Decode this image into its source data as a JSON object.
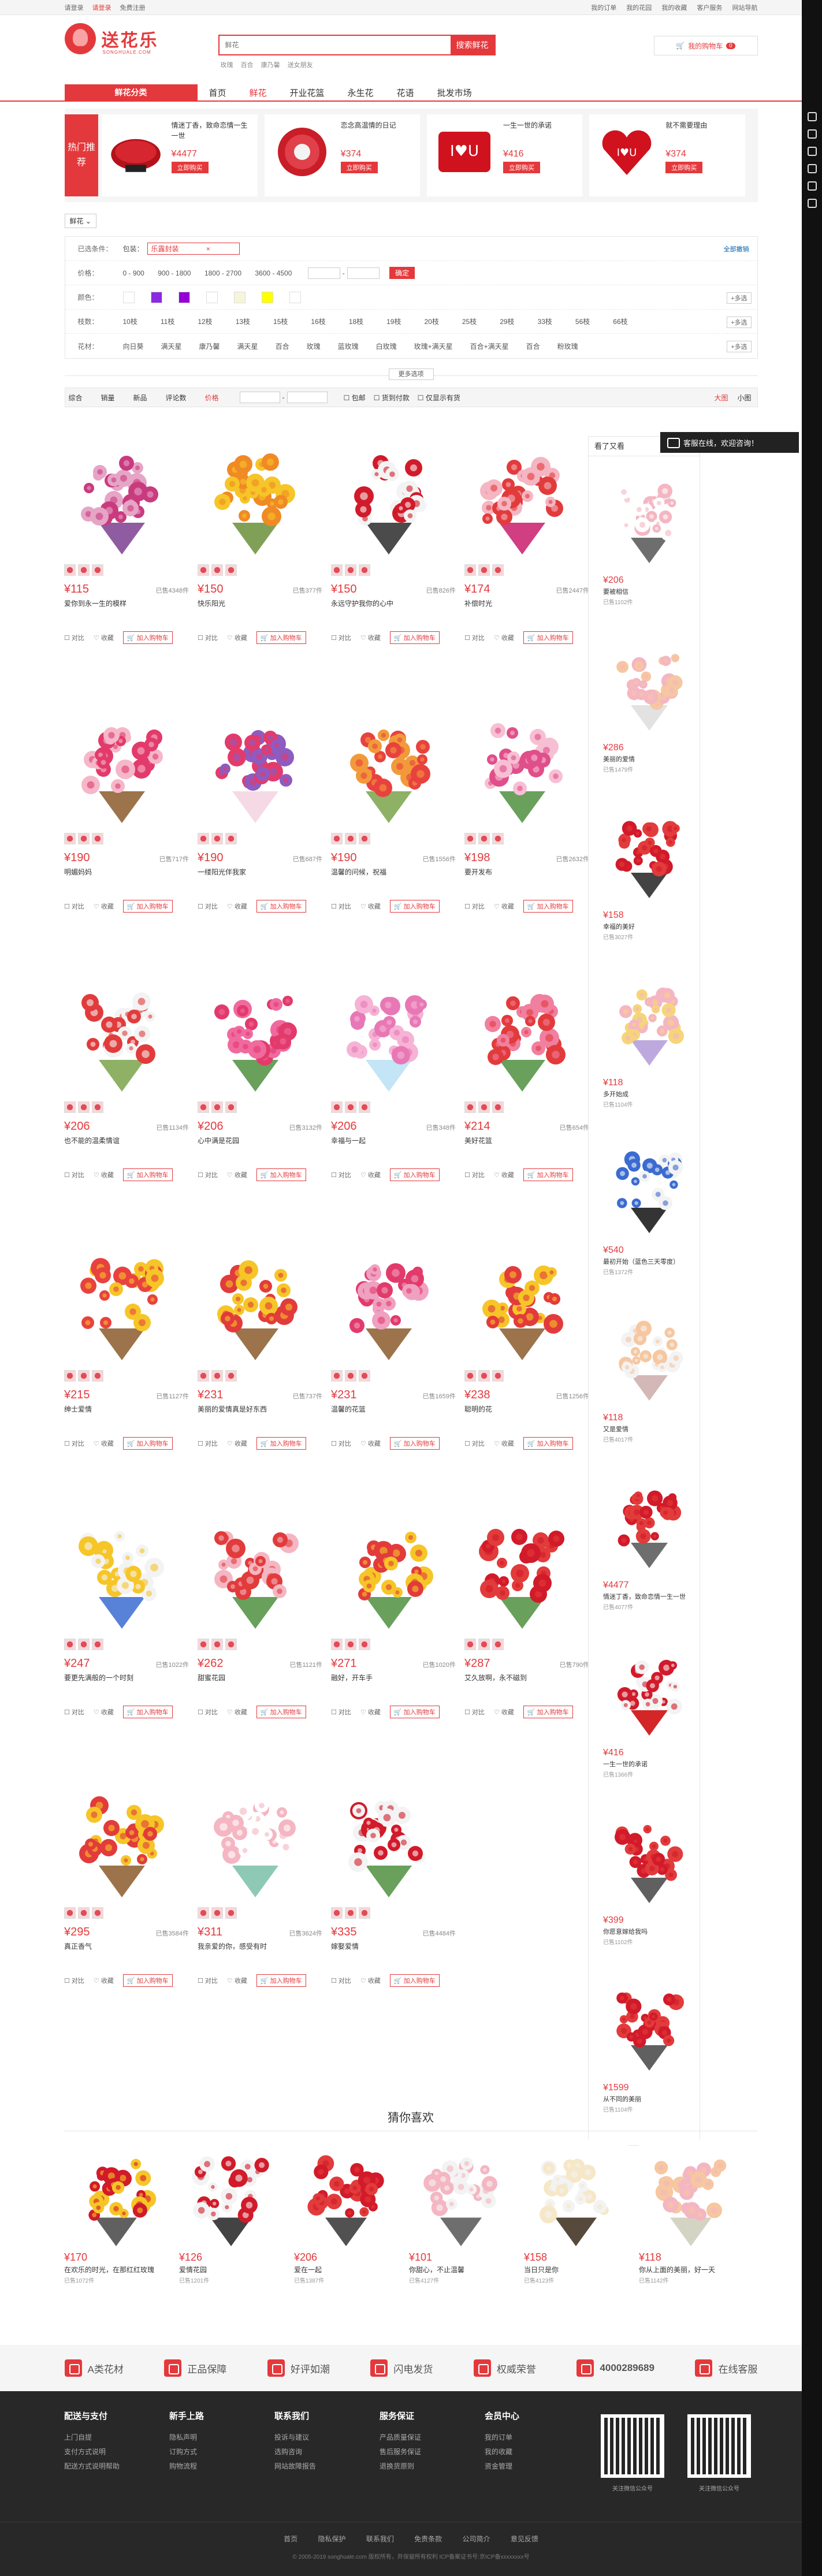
{
  "topbar": {
    "location": "请登录",
    "login": "请登录",
    "register": "免费注册",
    "right": [
      "我的订单",
      "我的花园",
      "我的收藏",
      "客户服务",
      "网站导航"
    ]
  },
  "header": {
    "logo_text": "送花乐",
    "logo_sub": "SONGHUALE.COM",
    "search_placeholder": "鲜花",
    "search_button": "搜索鲜花",
    "hot_words": [
      "玫瑰",
      "百合",
      "康乃馨",
      "送女朋友"
    ],
    "cart_label": "我的购物车",
    "cart_count": "0"
  },
  "nav": {
    "category_label": "鲜花分类",
    "items": [
      "首页",
      "鲜花",
      "开业花篮",
      "永生花",
      "花语",
      "批发市场"
    ],
    "active": 1
  },
  "hot_sales": {
    "label": "热门推荐",
    "items": [
      {
        "name": "情迷丁香，致命恋情一生一世",
        "price": "¥4477",
        "buy": "立即购买"
      },
      {
        "name": "恋念高温情的日记",
        "price": "¥374",
        "buy": "立即购买"
      },
      {
        "name": "一生一世的承诺",
        "price": "¥416",
        "buy": "立即购买"
      },
      {
        "name": "就不需要理由",
        "price": "¥374",
        "buy": "立即购买"
      }
    ]
  },
  "filters": {
    "crumb": "鲜花",
    "selected_label": "已选条件：",
    "selected_prefix": "包装：",
    "selected_tag": "乐露封装",
    "clear_all": "全部撤销",
    "price_label": "价格：",
    "price_ranges": [
      "0 - 900",
      "900 - 1800",
      "1800 - 2700",
      "3600 - 4500"
    ],
    "price_ok": "确定",
    "color_label": "颜色：",
    "color_swatches": [
      "#ffffff",
      "#8a2be2",
      "#9400d3",
      "#ffffff",
      "#f5f5dc",
      "#ffff00",
      "#ffffff"
    ],
    "count_label": "枝数：",
    "counts": [
      "10枝",
      "11枝",
      "12枝",
      "13枝",
      "15枝",
      "16枝",
      "18枝",
      "19枝",
      "20枝",
      "25枝",
      "29枝",
      "33枝",
      "56枝",
      "66枝"
    ],
    "kind_label": "花材：",
    "kinds": [
      "向日葵",
      "满天星",
      "康乃馨",
      "满天星",
      "百合",
      "玫瑰",
      "蓝玫瑰",
      "白玫瑰",
      "玫瑰+满天星",
      "百合+满天星",
      "百合",
      "粉玫瑰"
    ],
    "more": "+多选",
    "expand": "更多选项"
  },
  "sortbar": {
    "items": [
      "综合",
      "销量",
      "新品",
      "评论数",
      "价格"
    ],
    "active": 4,
    "checks": [
      "包邮",
      "货到付款",
      "仅显示有货"
    ],
    "view": [
      "大图",
      "小图"
    ]
  },
  "products": [
    {
      "price": "¥115",
      "sold": "已售4348件",
      "name": "爱你到永一生的模样"
    },
    {
      "price": "¥150",
      "sold": "已售377件",
      "name": "快乐阳光"
    },
    {
      "price": "¥150",
      "sold": "已售826件",
      "name": "永远守护我你的心中"
    },
    {
      "price": "¥174",
      "sold": "已售2447件",
      "name": "补偿时光"
    },
    {
      "price": "¥190",
      "sold": "已售717件",
      "name": "明媚妈妈"
    },
    {
      "price": "¥190",
      "sold": "已售687件",
      "name": "一缕阳光伴我家"
    },
    {
      "price": "¥190",
      "sold": "已售1556件",
      "name": "温馨的问候，祝福"
    },
    {
      "price": "¥198",
      "sold": "已售2632件",
      "name": "要开发布"
    },
    {
      "price": "¥206",
      "sold": "已售1134件",
      "name": "也不能的温柔情谊"
    },
    {
      "price": "¥206",
      "sold": "已售3132件",
      "name": "心中满是花园"
    },
    {
      "price": "¥206",
      "sold": "已售348件",
      "name": "幸福与一起"
    },
    {
      "price": "¥214",
      "sold": "已售654件",
      "name": "美好花篮"
    },
    {
      "price": "¥215",
      "sold": "已售1127件",
      "name": "绅士爱情"
    },
    {
      "price": "¥231",
      "sold": "已售737件",
      "name": "美丽的爱情真是好东西"
    },
    {
      "price": "¥231",
      "sold": "已售1659件",
      "name": "温馨的花篮"
    },
    {
      "price": "¥238",
      "sold": "已售1256件",
      "name": "聪明的花"
    },
    {
      "price": "¥247",
      "sold": "已售1022件",
      "name": "要更先满般的一个时刻"
    },
    {
      "price": "¥262",
      "sold": "已售1121件",
      "name": "甜蜜花园"
    },
    {
      "price": "¥271",
      "sold": "已售1020件",
      "name": "融好，开车手"
    },
    {
      "price": "¥287",
      "sold": "已售790件",
      "name": "艾久放啊，永不磁到"
    },
    {
      "price": "¥295",
      "sold": "已售3584件",
      "name": "真正香气"
    },
    {
      "price": "¥311",
      "sold": "已售3624件",
      "name": "我亲爱的你，感受有时"
    },
    {
      "price": "¥335",
      "sold": "已售4484件",
      "name": "嫁娶爱情"
    }
  ],
  "product_actions": {
    "compare": "对比",
    "fav": "收藏",
    "cart": "加入购物车"
  },
  "sidebar": {
    "title": "看了又看",
    "items": [
      {
        "price": "¥206",
        "name": "要被相信",
        "sold": "已售1102件"
      },
      {
        "price": "¥286",
        "name": "美丽的爱情",
        "sold": "已售1479件"
      },
      {
        "price": "¥158",
        "name": "幸福的美好",
        "sold": "已售3027件"
      },
      {
        "price": "¥118",
        "name": "多开始成",
        "sold": "已售1104件"
      },
      {
        "price": "¥540",
        "name": "最初开始（蓝色三天零度）",
        "sold": "已售1372件"
      },
      {
        "price": "¥118",
        "name": "又是爱情",
        "sold": "已售4017件"
      },
      {
        "price": "¥4477",
        "name": "情迷丁香，致命恋情一生一世",
        "sold": "已售4077件"
      },
      {
        "price": "¥416",
        "name": "一生一世的承诺",
        "sold": "已售1366件"
      },
      {
        "price": "¥399",
        "name": "你愿意嫁给我吗",
        "sold": "已售1102件"
      },
      {
        "price": "¥1599",
        "name": "从不同的美丽",
        "sold": "已售1104件"
      }
    ]
  },
  "guess": {
    "title": "猜你喜欢",
    "items": [
      {
        "price": "¥170",
        "name": "在欢乐的时光，在那红红玫瑰",
        "sold": "已售1072件"
      },
      {
        "price": "¥126",
        "name": "爱情花园",
        "sold": "已售1201件"
      },
      {
        "price": "¥206",
        "name": "爱在一起",
        "sold": "已售1387件"
      },
      {
        "price": "¥101",
        "name": "你甜心，不止温馨",
        "sold": "已售4127件"
      },
      {
        "price": "¥158",
        "name": "当日只是你",
        "sold": "已售4123件"
      },
      {
        "price": "¥118",
        "name": "你从上面的美丽，好一天",
        "sold": "已售1142件"
      }
    ]
  },
  "services": [
    "A类花材",
    "正品保障",
    "好评如潮",
    "闪电发货",
    "权威荣誉",
    "4000289689",
    "在线客服"
  ],
  "footer": {
    "cols": [
      {
        "title": "配送与支付",
        "items": [
          "上门自提",
          "支付方式说明",
          "配送方式说明帮助"
        ]
      },
      {
        "title": "新手上路",
        "items": [
          "隐私声明",
          "订购方式",
          "购物流程"
        ]
      },
      {
        "title": "联系我们",
        "items": [
          "投诉与建议",
          "选购咨询",
          "网站故障报告"
        ]
      },
      {
        "title": "服务保证",
        "items": [
          "产品质量保证",
          "售后服务保证",
          "退换货原则"
        ]
      },
      {
        "title": "会员中心",
        "items": [
          "我的订单",
          "我的收藏",
          "资金管理"
        ]
      }
    ],
    "qr1": "关注微信公众号",
    "qr2": "关注微信公众号",
    "bottom": [
      "首页",
      "隐私保护",
      "联系我们",
      "免责条款",
      "公司简介",
      "意见反馈"
    ],
    "copyright": "© 2005-2019 songhuale.com 版权所有，并保留所有权利 ICP备案证书号:京ICP备xxxxxxxx号"
  },
  "chat": "客服在线，欢迎咨询！"
}
